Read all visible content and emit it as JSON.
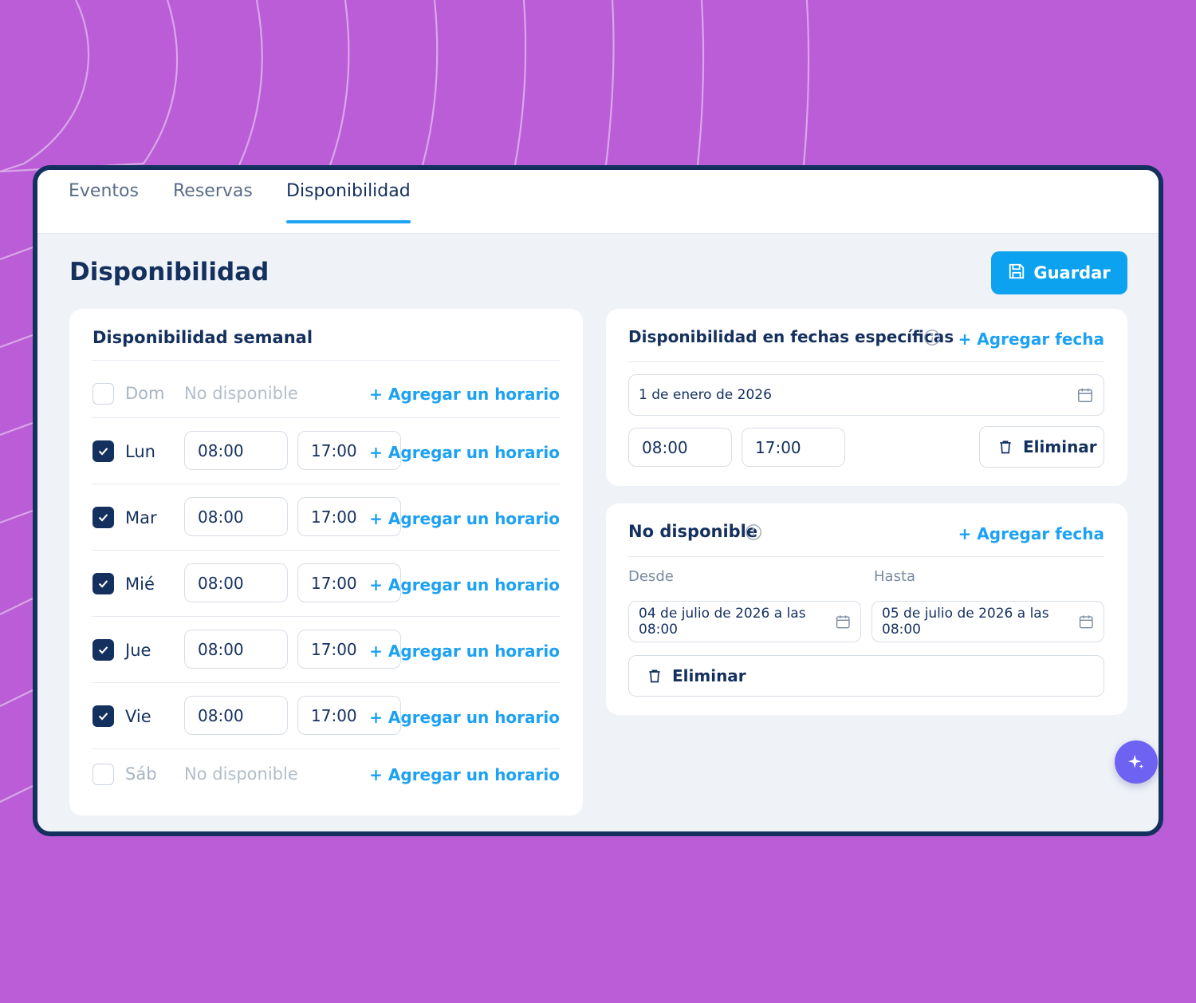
{
  "tabs": [
    {
      "label": "Eventos"
    },
    {
      "label": "Reservas"
    },
    {
      "label": "Disponibilidad",
      "active": true
    }
  ],
  "page": {
    "title": "Disponibilidad",
    "save_label": "Guardar"
  },
  "weekly": {
    "title": "Disponibilidad semanal",
    "add_label": "+ Agregar un horario",
    "unavailable_label": "No disponible",
    "days": [
      {
        "label": "Dom",
        "enabled": false
      },
      {
        "label": "Lun",
        "enabled": true,
        "start": "08:00",
        "end": "17:00"
      },
      {
        "label": "Mar",
        "enabled": true,
        "start": "08:00",
        "end": "17:00"
      },
      {
        "label": "Mié",
        "enabled": true,
        "start": "08:00",
        "end": "17:00"
      },
      {
        "label": "Jue",
        "enabled": true,
        "start": "08:00",
        "end": "17:00"
      },
      {
        "label": "Vie",
        "enabled": true,
        "start": "08:00",
        "end": "17:00"
      },
      {
        "label": "Sáb",
        "enabled": false
      }
    ]
  },
  "specific": {
    "title": "Disponibilidad en fechas específicas",
    "add_label": "+ Agregar fecha",
    "date": "1 de enero de 2026",
    "start": "08:00",
    "end": "17:00",
    "delete_label": "Eliminar"
  },
  "unavailable": {
    "title": "No disponible",
    "add_label": "+ Agregar fecha",
    "from_label": "Desde",
    "to_label": "Hasta",
    "from_value": "04 de julio de 2026 a las 08:00",
    "to_value": "05 de julio de 2026 a las 08:00",
    "delete_label": "Eliminar"
  },
  "colors": {
    "background": "#bb5dd6",
    "frame": "#14305e",
    "accent": "#1da1f2",
    "primary_button": "#0da2f0",
    "fab": "#6e62f2"
  },
  "icons": {
    "save": "floppy-disk-icon",
    "calendar": "calendar-icon",
    "delete": "trash-icon",
    "info": "info-icon",
    "check": "checkmark-icon",
    "fab": "sparkle-icon"
  }
}
